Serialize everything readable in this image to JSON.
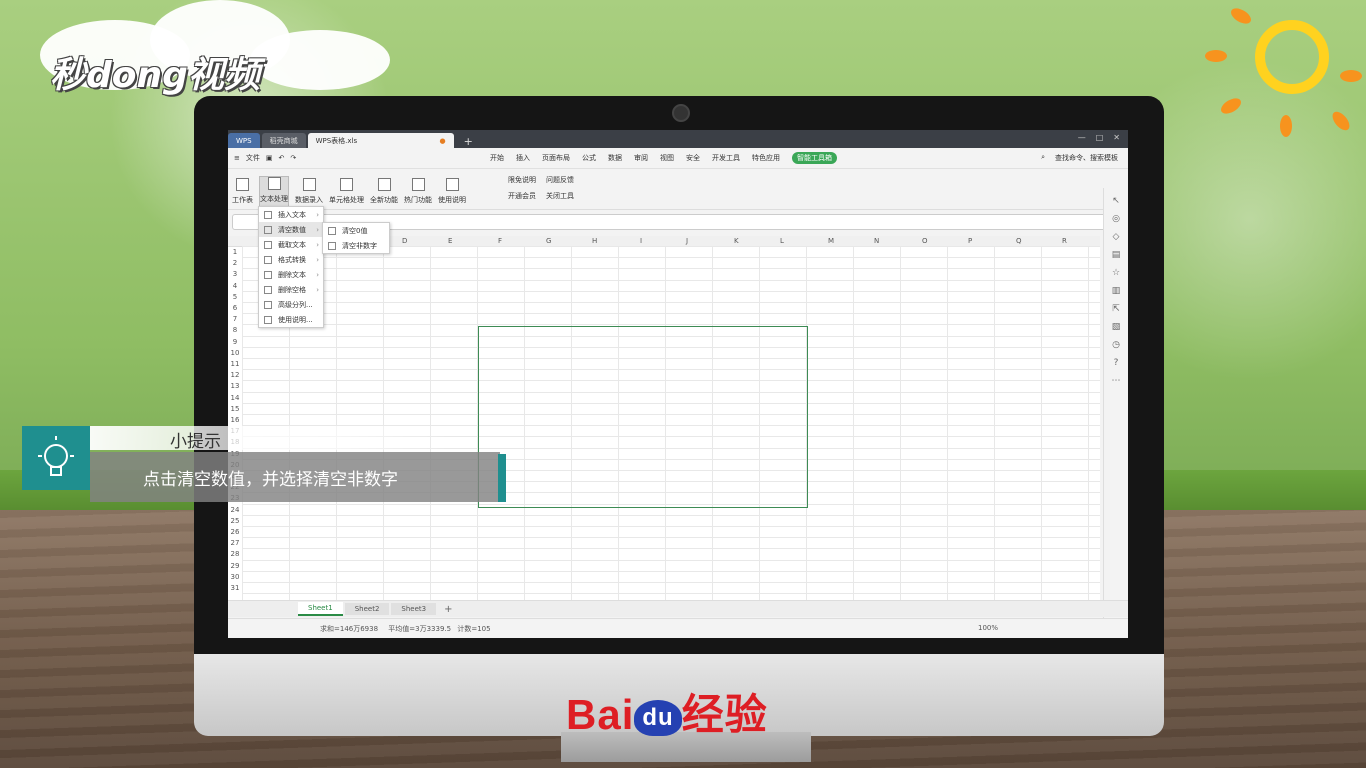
{
  "brand_top": "秒dong视频",
  "tip": {
    "title": "小提示",
    "body": "点击清空数值，并选择清空非数字"
  },
  "watermark": {
    "baidu": "Bai",
    "du": "du",
    "jingyan": "经验"
  },
  "app": {
    "tabs": [
      {
        "label": "WPS"
      },
      {
        "label": "稻壳商城"
      },
      {
        "label": "WPS表格.xls"
      }
    ],
    "file_menu": "文件",
    "menu": [
      "开始",
      "插入",
      "页面布局",
      "公式",
      "数据",
      "审阅",
      "视图",
      "安全",
      "开发工具",
      "特色应用"
    ],
    "smart_toolbox": "智能工具箱",
    "search": "查找命令、搜索模板",
    "ribbon": [
      "工作表",
      "文本处理",
      "数据录入",
      "单元格处理",
      "全新功能",
      "热门功能",
      "使用说明"
    ],
    "ribbon_small": [
      "限免说明",
      "问题反馈",
      "开通会员",
      "关闭工具"
    ],
    "dropdown": [
      "插入文本",
      "清空数值",
      "截取文本",
      "格式转换",
      "删除文本",
      "删除空格",
      "高级分列...",
      "使用说明..."
    ],
    "submenu": [
      "清空0值",
      "清空非数字"
    ],
    "columns": [
      "D",
      "E",
      "F",
      "G",
      "H",
      "I",
      "J",
      "K",
      "L",
      "M",
      "N",
      "O",
      "P",
      "Q",
      "R"
    ],
    "sheets": [
      "Sheet1",
      "Sheet2",
      "Sheet3"
    ],
    "status": {
      "sum": "求和=146万6938",
      "avg": "平均值=3万3339.5",
      "count": "计数=105",
      "zoom": "100%"
    }
  },
  "colors": {
    "accent": "#2b8b46",
    "teal": "#1f8f8f",
    "baidu_red": "#de1e24",
    "baidu_blue": "#2541b2"
  }
}
